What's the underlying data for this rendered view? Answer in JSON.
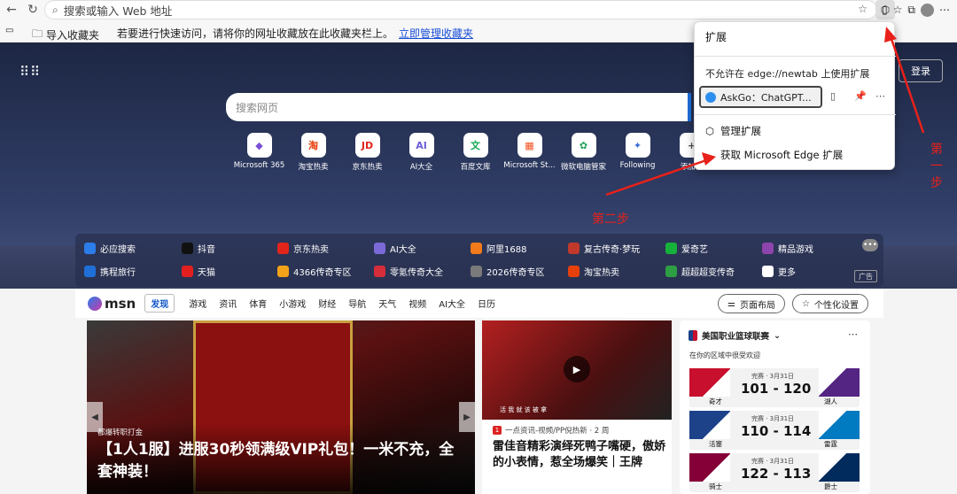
{
  "toolbar": {
    "address_placeholder": "搜索或输入 Web 地址"
  },
  "favbar": {
    "import_label": "导入收藏夹",
    "hint": "若要进行快速访问，请将你的网址收藏放在此收藏夹栏上。",
    "manage_link": "立即管理收藏夹"
  },
  "header": {
    "login": "登录"
  },
  "search": {
    "placeholder": "搜索网页"
  },
  "tiles": [
    {
      "label": "Microsoft 365",
      "glyph": "◆",
      "color": "#7b4fd6"
    },
    {
      "label": "淘宝热卖",
      "glyph": "淘",
      "color": "#e8400c"
    },
    {
      "label": "京东热卖",
      "glyph": "JD",
      "color": "#e1251b"
    },
    {
      "label": "AI大全",
      "glyph": "AI",
      "color": "#6a5cd8"
    },
    {
      "label": "百度文库",
      "glyph": "文",
      "color": "#13a854"
    },
    {
      "label": "Microsoft St...",
      "glyph": "▦",
      "color": "#f25022"
    },
    {
      "label": "微软电脑管家",
      "glyph": "✿",
      "color": "#1f9d55"
    },
    {
      "label": "Following",
      "glyph": "✦",
      "color": "#3a6fd8"
    },
    {
      "label": "添加快",
      "glyph": "+",
      "color": "#555"
    }
  ],
  "links": [
    {
      "label": "必应搜索",
      "color": "#2b7de9"
    },
    {
      "label": "抖音",
      "color": "#111"
    },
    {
      "label": "京东热卖",
      "color": "#e1251b"
    },
    {
      "label": "AI大全",
      "color": "#7a6ad8"
    },
    {
      "label": "阿里1688",
      "color": "#f27a1a"
    },
    {
      "label": "复古传奇·梦玩",
      "color": "#c0392b"
    },
    {
      "label": "爱奇艺",
      "color": "#16b13a"
    },
    {
      "label": "精品游戏",
      "color": "#8e44ad"
    },
    {
      "label": "携程旅行",
      "color": "#1f6fd8"
    },
    {
      "label": "天猫",
      "color": "#e21f1f"
    },
    {
      "label": "4366传奇专区",
      "color": "#f2a21a"
    },
    {
      "label": "零氪传奇大全",
      "color": "#d62d3a"
    },
    {
      "label": "2026传奇专区",
      "color": "#7a7a7a"
    },
    {
      "label": "淘宝热卖",
      "color": "#e8400c"
    },
    {
      "label": "超超超变传奇",
      "color": "#2e9e44"
    },
    {
      "label": "更多",
      "color": "#ffffff"
    }
  ],
  "ad_label": "广告",
  "msn": {
    "logo": "msn",
    "tabs": [
      "发现",
      "游戏",
      "资讯",
      "体育",
      "小游戏",
      "财经",
      "导航",
      "天气",
      "视频",
      "AI大全",
      "日历"
    ],
    "layout_btn": "页面布局",
    "personalize_btn": "个性化设置"
  },
  "card1": {
    "source": "都爆转职打金",
    "title": "【1人1服】进服30秒领满级VIP礼包！一米不充，全套神装！"
  },
  "card2": {
    "source": "一点资讯-视频/PP倪热新 · 2 周",
    "title": "雷佳音精彩演绎死鸭子嘴硬，傲娇的小表情，惹全场爆笑｜王牌",
    "caption": "活 我 就 该 被 拿",
    "dot": "1"
  },
  "nba": {
    "title": "美国职业篮球联赛",
    "subtitle": "在你的区域中很受欢迎",
    "games": [
      {
        "status": "完赛 · 3月31日",
        "score": "101 - 120",
        "team1": "奇才",
        "team2": "湖人",
        "c1": "#c8102e",
        "c2": "#552583"
      },
      {
        "status": "完赛 · 3月31日",
        "score": "110 - 114",
        "team1": "活塞",
        "team2": "雷霆",
        "c1": "#1d428a",
        "c2": "#007ac1"
      },
      {
        "status": "完赛 · 3月31日",
        "score": "122 - 113",
        "team1": "骑士",
        "team2": "爵士",
        "c1": "#860038",
        "c2": "#002b5c"
      }
    ]
  },
  "popup": {
    "title": "扩展",
    "note": "不允许在 edge://newtab 上使用扩展",
    "ext_name": "AskGo：ChatGPT...",
    "manage": "管理扩展",
    "get": "获取 Microsoft Edge 扩展"
  },
  "annotations": {
    "step1": "第一步",
    "step2": "第二步"
  }
}
